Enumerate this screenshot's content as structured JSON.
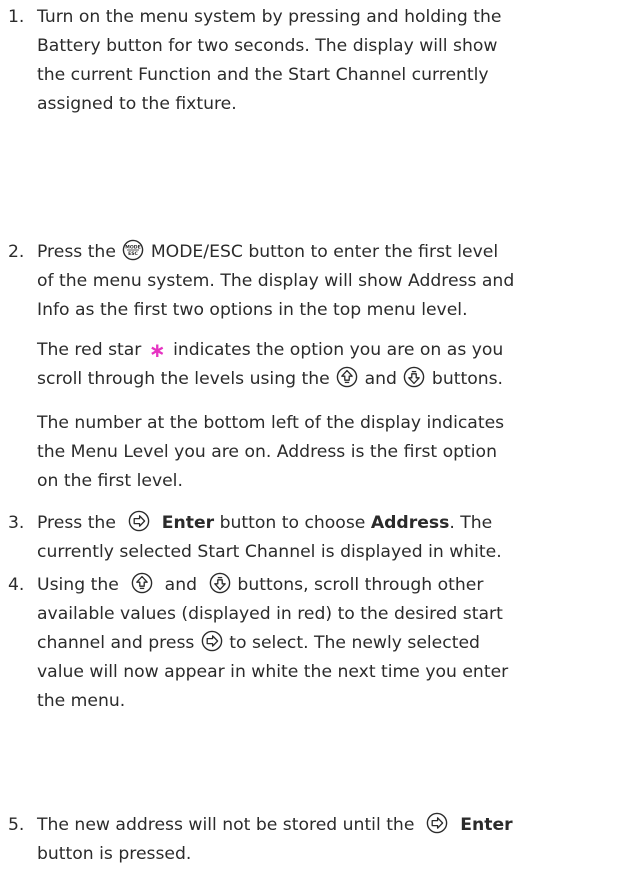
{
  "steps": [
    {
      "number": "1.",
      "lines": [
        "Turn on the menu system by pressing and holding the",
        "Battery button for two seconds. The display will show",
        "the current Function and the Start Channel currently",
        "assigned to the fixture."
      ]
    },
    {
      "number": "2.",
      "line1_pre": "Press the",
      "line1_post": "MODE/ESC button to enter the first level",
      "line2": "of the menu system. The display will show Address and",
      "line3": "Info as the first two options in the top menu level.",
      "p2_line1_pre": "The red star",
      "p2_line1_post": "indicates the option you are on as you",
      "p2_line2_pre": "scroll through the levels using the",
      "p2_line2_mid": "and",
      "p2_line2_post": "buttons.",
      "p3_lines": [
        "The number at the bottom left of the display indicates",
        "the Menu Level you are on. Address is the first option",
        "on the first level."
      ],
      "star_glyph": "∗"
    },
    {
      "number": "3.",
      "line1_pre": "Press the",
      "line1_bold": "Enter",
      "line1_mid": "button to choose",
      "line1_bold2": "Address",
      "line1_post": ". The",
      "line2": "currently selected Start Channel is displayed in white."
    },
    {
      "number": "4.",
      "line1_pre": "Using the",
      "line1_mid": "and",
      "line1_post": "buttons, scroll through other",
      "line2": "available values (displayed in red) to the desired start",
      "line3_pre": "channel and press",
      "line3_post": "to select. The newly selected",
      "line4": "value will now appear in white the next time you enter",
      "line5": "the menu."
    },
    {
      "number": "5.",
      "line1_pre": "The new address will not be stored until the",
      "line1_bold": "Enter",
      "line2": "button is pressed."
    }
  ],
  "icons": {
    "mode_esc_top": "MODE",
    "mode_esc_bottom": "ESC",
    "up": "up-arrow-button-icon",
    "down": "down-arrow-button-icon",
    "enter": "enter-button-icon"
  },
  "colors": {
    "star": "#e633c2",
    "text": "#2b2b2b"
  }
}
